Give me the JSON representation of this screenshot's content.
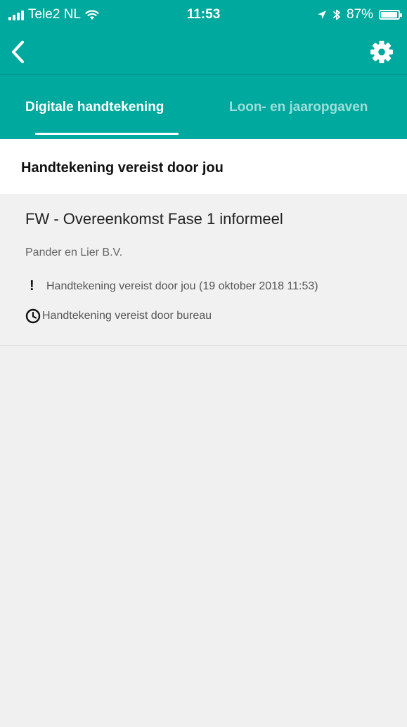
{
  "statusbar": {
    "carrier": "Tele2 NL",
    "time": "11:53",
    "battery": "87%",
    "battery_level": 0.87
  },
  "navbar": {
    "back_icon": "chevron-left-icon",
    "settings_icon": "gear-icon"
  },
  "tabs": [
    {
      "label": "Digitale handtekening",
      "active": true
    },
    {
      "label": "Loon- en jaaropgaven",
      "active": false
    }
  ],
  "section": {
    "title": "Handtekening vereist door jou"
  },
  "items": [
    {
      "title": "FW - Overeenkomst Fase 1 informeel",
      "company": "Pander en Lier B.V.",
      "statuses": [
        {
          "icon": "exclamation-icon",
          "text": "Handtekening vereist door jou (19 oktober 2018 11:53)"
        },
        {
          "icon": "clock-icon",
          "text": "Handtekening vereist door bureau"
        }
      ]
    }
  ],
  "colors": {
    "accent": "#00a99d",
    "background": "#f0f0f0"
  }
}
